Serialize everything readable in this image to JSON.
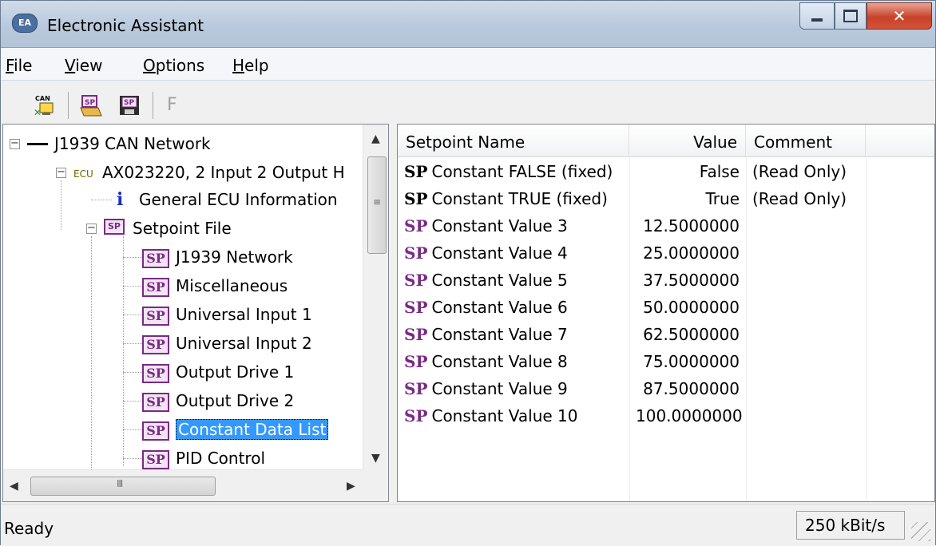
{
  "window": {
    "title": "Electronic Assistant",
    "app_icon_text": "EA"
  },
  "menu": {
    "items": [
      {
        "label": "File",
        "u": "F",
        "rest": "ile"
      },
      {
        "label": "View",
        "u": "V",
        "rest": "iew"
      },
      {
        "label": "Options",
        "u": "O",
        "rest": "ptions"
      },
      {
        "label": "Help",
        "u": "H",
        "rest": "elp"
      }
    ]
  },
  "toolbar": {
    "can_label": "CAN",
    "f_label": "F"
  },
  "tree": {
    "root": "J1939 CAN Network",
    "ecu_tag": "ECU",
    "ecu": "AX023220, 2 Input 2 Output H",
    "info": "General ECU Information",
    "setpoint_file": "Setpoint File",
    "sp_badge": "SP",
    "items": [
      "J1939 Network",
      "Miscellaneous",
      "Universal Input 1",
      "Universal Input 2",
      "Output Drive 1",
      "Output Drive 2",
      "Constant Data List",
      "PID Control"
    ],
    "selected": "Constant Data List"
  },
  "list": {
    "headers": {
      "name": "Setpoint Name",
      "value": "Value",
      "comment": "Comment"
    },
    "sp_mark": "SP",
    "rows": [
      {
        "name": "Constant FALSE (fixed)",
        "value": "False",
        "comment": "(Read Only)",
        "mark": "black"
      },
      {
        "name": "Constant TRUE (fixed)",
        "value": "True",
        "comment": "(Read Only)",
        "mark": "black"
      },
      {
        "name": "Constant Value 3",
        "value": "12.5000000",
        "comment": "",
        "mark": "purple"
      },
      {
        "name": "Constant Value 4",
        "value": "25.0000000",
        "comment": "",
        "mark": "purple"
      },
      {
        "name": "Constant Value 5",
        "value": "37.5000000",
        "comment": "",
        "mark": "purple"
      },
      {
        "name": "Constant Value 6",
        "value": "50.0000000",
        "comment": "",
        "mark": "purple"
      },
      {
        "name": "Constant Value 7",
        "value": "62.5000000",
        "comment": "",
        "mark": "purple"
      },
      {
        "name": "Constant Value 8",
        "value": "75.0000000",
        "comment": "",
        "mark": "purple"
      },
      {
        "name": "Constant Value 9",
        "value": "87.5000000",
        "comment": "",
        "mark": "purple"
      },
      {
        "name": "Constant Value 10",
        "value": "100.0000000",
        "comment": "",
        "mark": "purple"
      }
    ]
  },
  "status": {
    "text": "Ready",
    "baud": "250 kBit/s"
  },
  "colors": {
    "selection": "#3399ff",
    "sp_purple": "#7a2a84"
  }
}
